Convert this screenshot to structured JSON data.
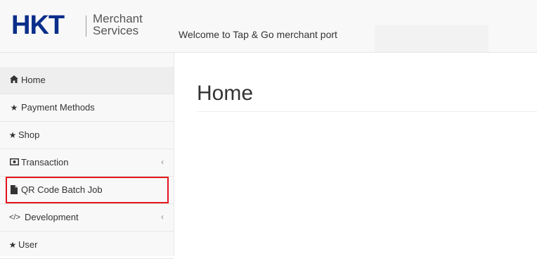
{
  "header": {
    "logo_main": "HKT",
    "logo_sub_line1": "Merchant",
    "logo_sub_line2": "Services",
    "welcome_text": "Welcome to Tap & Go merchant port"
  },
  "sidebar": {
    "items": [
      {
        "label": "Home",
        "icon": "home-icon",
        "active": true
      },
      {
        "label": "Payment Methods",
        "icon": "star-icon"
      },
      {
        "label": "Shop",
        "icon": "star-icon"
      },
      {
        "label": "Transaction",
        "icon": "money-icon",
        "has_submenu": true
      },
      {
        "label": "QR Code Batch Job",
        "icon": "file-icon",
        "highlighted": true
      },
      {
        "label": "Development",
        "icon": "code-icon",
        "has_submenu": true
      },
      {
        "label": "User",
        "icon": "star-icon"
      }
    ],
    "chevron": "‹"
  },
  "main": {
    "page_title": "Home"
  },
  "colors": {
    "brand_blue": "#0a2e8a",
    "highlight_red": "#e3141c"
  }
}
